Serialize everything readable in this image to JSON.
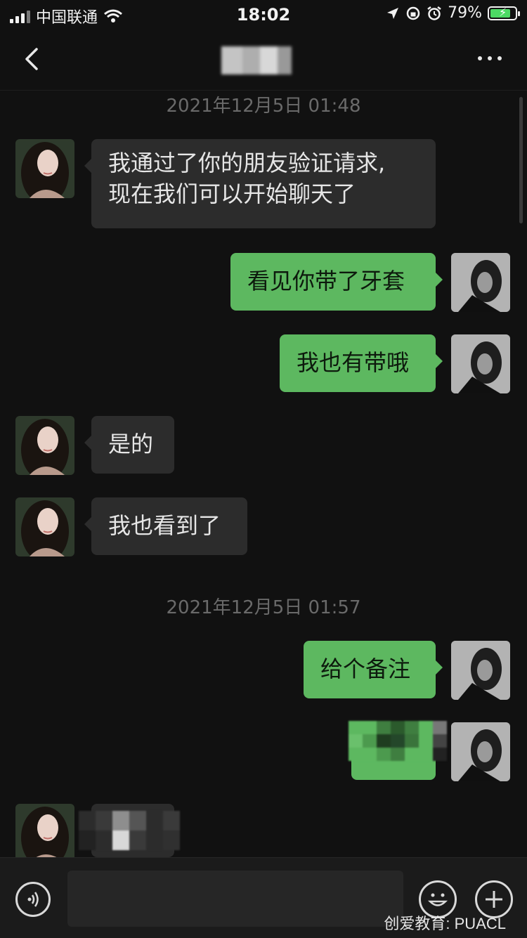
{
  "status_bar": {
    "carrier": "中国联通",
    "time": "18:02",
    "battery": "79%",
    "battery_level": 0.79,
    "icons": [
      "signal-icon",
      "wifi-icon",
      "location-icon",
      "rotation-lock-icon",
      "alarm-icon",
      "battery-charging-icon"
    ]
  },
  "nav": {
    "back_icon": "chevron-left-icon",
    "more_icon": "more-dots-icon"
  },
  "messages": {
    "ts1": "2021年12月5日 01:48",
    "m1": [
      "我通过了你的朋友验证请求,",
      "现在我们可以开始聊天了"
    ],
    "m2": "看见你带了牙套",
    "m3": "我也有带哦",
    "m4": "是的",
    "m5": "我也看到了",
    "ts2": "2021年12月5日 01:57",
    "m6": "给个备注"
  },
  "input_bar": {
    "voice_icon": "voice-icon",
    "emoji_icon": "emoji-icon",
    "plus_icon": "plus-icon"
  },
  "watermark": "创爱教育: PUACL",
  "colors": {
    "background": "#111111",
    "incoming_bubble": "#2c2c2c",
    "outgoing_bubble": "#5db860",
    "timestamp": "#6a6a6a"
  }
}
